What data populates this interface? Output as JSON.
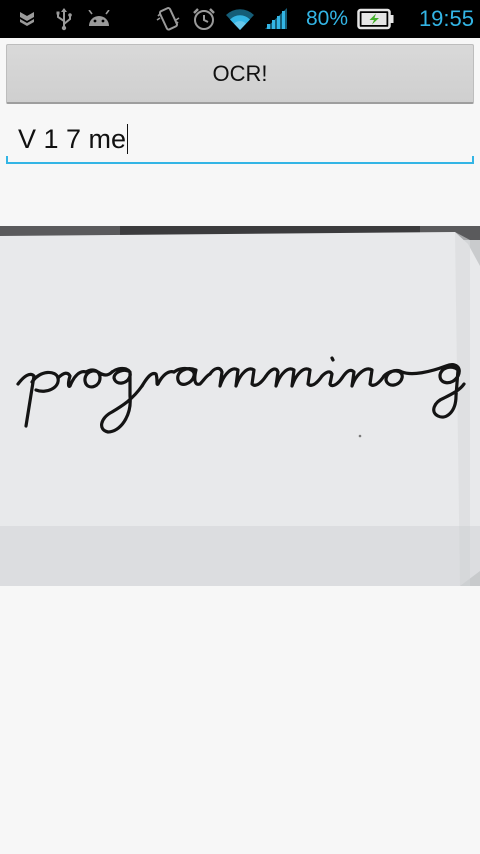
{
  "status_bar": {
    "icons": {
      "notification": "shield-chevron-icon",
      "usb": "usb-icon",
      "debug": "android-icon",
      "vibrate": "vibrate-icon",
      "alarm": "alarm-clock-icon",
      "wifi": "wifi-icon",
      "signal": "signal-icon",
      "battery": "battery-charging-icon"
    },
    "battery_percent": "80%",
    "time": "19:55",
    "accent_color": "#33b5e5"
  },
  "ocr_button": {
    "label": "OCR!"
  },
  "result_field": {
    "value": "V 1 7 me"
  },
  "photo": {
    "handwritten_text": "programming"
  }
}
